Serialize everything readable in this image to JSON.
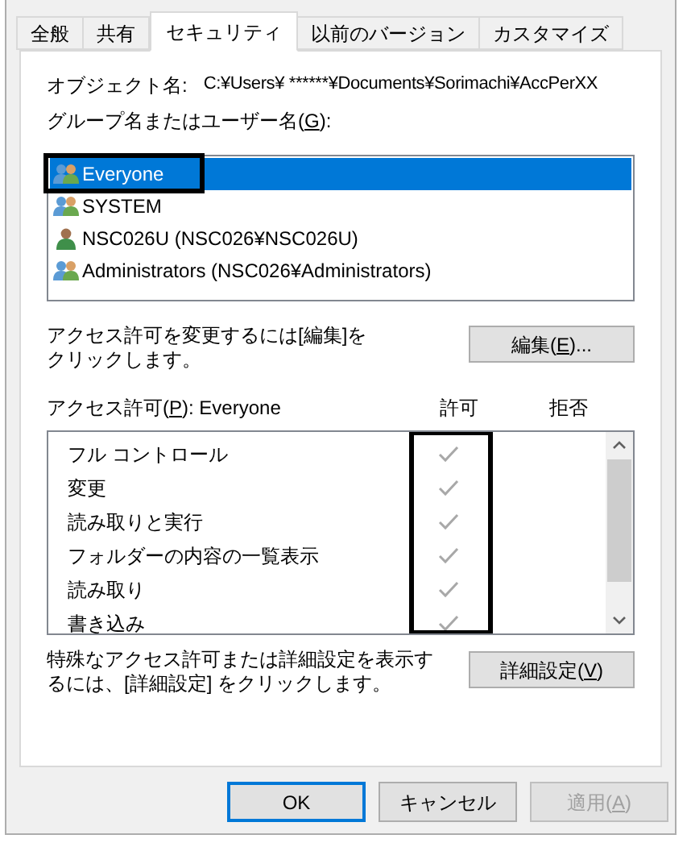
{
  "tabs": [
    {
      "label": "全般",
      "selected": false
    },
    {
      "label": "共有",
      "selected": false
    },
    {
      "label": "セキュリティ",
      "selected": true
    },
    {
      "label": "以前のバージョン",
      "selected": false
    },
    {
      "label": "カスタマイズ",
      "selected": false
    }
  ],
  "object_name": {
    "label": "オブジェクト名:",
    "value": "C:¥Users¥ ******¥Documents¥Sorimachi¥AccPerXX"
  },
  "principals_label": [
    "グループ名またはユーザー名(",
    "G",
    "):"
  ],
  "principals": [
    {
      "name": "Everyone",
      "kind": "group",
      "selected": true,
      "outlined": true
    },
    {
      "name": "SYSTEM",
      "kind": "group",
      "selected": false,
      "outlined": false
    },
    {
      "name": "NSC026U (NSC026¥NSC026U)",
      "kind": "user",
      "selected": false,
      "outlined": false
    },
    {
      "name": "Administrators (NSC026¥Administrators)",
      "kind": "group",
      "selected": false,
      "outlined": false
    }
  ],
  "edit_hint": "アクセス許可を変更するには[編集]をクリックします。",
  "edit_button": [
    "編集(",
    "E",
    ")..."
  ],
  "permissions_label": [
    "アクセス許可(",
    "P",
    "): Everyone"
  ],
  "allow_header": "許可",
  "deny_header": "拒否",
  "allow_column_outlined": true,
  "permissions": [
    {
      "name": "フル コントロール",
      "allow": true,
      "deny": false
    },
    {
      "name": "変更",
      "allow": true,
      "deny": false
    },
    {
      "name": "読み取りと実行",
      "allow": true,
      "deny": false
    },
    {
      "name": "フォルダーの内容の一覧表示",
      "allow": true,
      "deny": false
    },
    {
      "name": "読み取り",
      "allow": true,
      "deny": false
    },
    {
      "name": "書き込み",
      "allow": true,
      "deny": false
    }
  ],
  "advanced_hint": "特殊なアクセス許可または詳細設定を表示するには、[詳細設定] をクリックします。",
  "advanced_button": [
    "詳細設定(",
    "V",
    ")"
  ],
  "buttons": [
    {
      "label": [
        "OK"
      ],
      "kind": "default",
      "disabled": false
    },
    {
      "label": [
        "キャンセル"
      ],
      "kind": "normal",
      "disabled": false
    },
    {
      "label": [
        "適用(",
        "A",
        ")"
      ],
      "kind": "normal",
      "disabled": true
    }
  ]
}
